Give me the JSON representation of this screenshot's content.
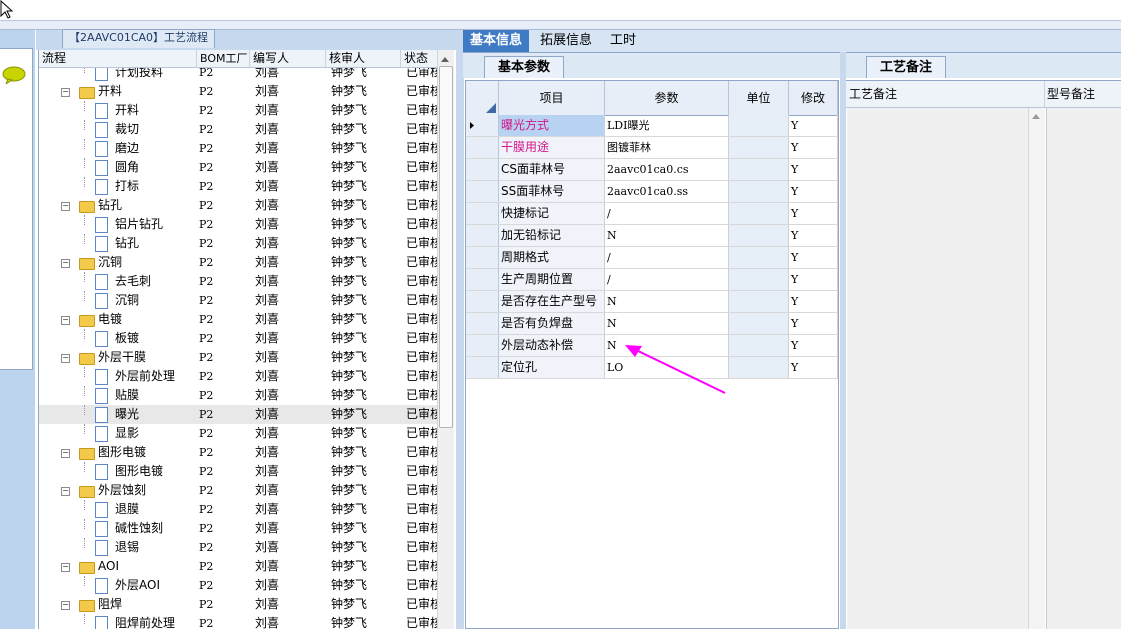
{
  "window": {
    "title": "【2AAVC01CA0】工艺流程"
  },
  "tree": {
    "columns": [
      "流程",
      "BOM工厂",
      "编写人",
      "核审人",
      "状态"
    ],
    "rows": [
      {
        "name": "计划投料",
        "type": "doc",
        "level": 1,
        "bom": "P2",
        "writer": "刘喜",
        "reviewer": "钟梦飞",
        "status": "已审核"
      },
      {
        "name": "开料",
        "type": "folder",
        "level": 0,
        "bom": "P2",
        "writer": "刘喜",
        "reviewer": "钟梦飞",
        "status": "已审核"
      },
      {
        "name": "开料",
        "type": "doc",
        "level": 1,
        "bom": "P2",
        "writer": "刘喜",
        "reviewer": "钟梦飞",
        "status": "已审核"
      },
      {
        "name": "裁切",
        "type": "doc",
        "level": 1,
        "bom": "P2",
        "writer": "刘喜",
        "reviewer": "钟梦飞",
        "status": "已审核"
      },
      {
        "name": "磨边",
        "type": "doc",
        "level": 1,
        "bom": "P2",
        "writer": "刘喜",
        "reviewer": "钟梦飞",
        "status": "已审核"
      },
      {
        "name": "圆角",
        "type": "doc",
        "level": 1,
        "bom": "P2",
        "writer": "刘喜",
        "reviewer": "钟梦飞",
        "status": "已审核"
      },
      {
        "name": "打标",
        "type": "doc",
        "level": 1,
        "bom": "P2",
        "writer": "刘喜",
        "reviewer": "钟梦飞",
        "status": "已审核"
      },
      {
        "name": "钻孔",
        "type": "folder",
        "level": 0,
        "bom": "P2",
        "writer": "刘喜",
        "reviewer": "钟梦飞",
        "status": "已审核"
      },
      {
        "name": "铝片钻孔",
        "type": "doc",
        "level": 1,
        "bom": "P2",
        "writer": "刘喜",
        "reviewer": "钟梦飞",
        "status": "已审核"
      },
      {
        "name": "钻孔",
        "type": "doc",
        "level": 1,
        "bom": "P2",
        "writer": "刘喜",
        "reviewer": "钟梦飞",
        "status": "已审核"
      },
      {
        "name": "沉铜",
        "type": "folder",
        "level": 0,
        "bom": "P2",
        "writer": "刘喜",
        "reviewer": "钟梦飞",
        "status": "已审核"
      },
      {
        "name": "去毛刺",
        "type": "doc",
        "level": 1,
        "bom": "P2",
        "writer": "刘喜",
        "reviewer": "钟梦飞",
        "status": "已审核"
      },
      {
        "name": "沉铜",
        "type": "doc",
        "level": 1,
        "bom": "P2",
        "writer": "刘喜",
        "reviewer": "钟梦飞",
        "status": "已审核"
      },
      {
        "name": "电镀",
        "type": "folder",
        "level": 0,
        "bom": "P2",
        "writer": "刘喜",
        "reviewer": "钟梦飞",
        "status": "已审核"
      },
      {
        "name": "板镀",
        "type": "doc",
        "level": 1,
        "bom": "P2",
        "writer": "刘喜",
        "reviewer": "钟梦飞",
        "status": "已审核"
      },
      {
        "name": "外层干膜",
        "type": "folder",
        "level": 0,
        "bom": "P2",
        "writer": "刘喜",
        "reviewer": "钟梦飞",
        "status": "已审核"
      },
      {
        "name": "外层前处理",
        "type": "doc",
        "level": 1,
        "bom": "P2",
        "writer": "刘喜",
        "reviewer": "钟梦飞",
        "status": "已审核"
      },
      {
        "name": "贴膜",
        "type": "doc",
        "level": 1,
        "bom": "P2",
        "writer": "刘喜",
        "reviewer": "钟梦飞",
        "status": "已审核"
      },
      {
        "name": "曝光",
        "type": "doc",
        "level": 1,
        "bom": "P2",
        "writer": "刘喜",
        "reviewer": "钟梦飞",
        "status": "已审核",
        "selected": true
      },
      {
        "name": "显影",
        "type": "doc",
        "level": 1,
        "bom": "P2",
        "writer": "刘喜",
        "reviewer": "钟梦飞",
        "status": "已审核"
      },
      {
        "name": "图形电镀",
        "type": "folder",
        "level": 0,
        "bom": "P2",
        "writer": "刘喜",
        "reviewer": "钟梦飞",
        "status": "已审核"
      },
      {
        "name": "图形电镀",
        "type": "doc",
        "level": 1,
        "bom": "P2",
        "writer": "刘喜",
        "reviewer": "钟梦飞",
        "status": "已审核"
      },
      {
        "name": "外层蚀刻",
        "type": "folder",
        "level": 0,
        "bom": "P2",
        "writer": "刘喜",
        "reviewer": "钟梦飞",
        "status": "已审核"
      },
      {
        "name": "退膜",
        "type": "doc",
        "level": 1,
        "bom": "P2",
        "writer": "刘喜",
        "reviewer": "钟梦飞",
        "status": "已审核"
      },
      {
        "name": "碱性蚀刻",
        "type": "doc",
        "level": 1,
        "bom": "P2",
        "writer": "刘喜",
        "reviewer": "钟梦飞",
        "status": "已审核"
      },
      {
        "name": "退锡",
        "type": "doc",
        "level": 1,
        "bom": "P2",
        "writer": "刘喜",
        "reviewer": "钟梦飞",
        "status": "已审核"
      },
      {
        "name": "AOI",
        "type": "folder",
        "level": 0,
        "bom": "P2",
        "writer": "刘喜",
        "reviewer": "钟梦飞",
        "status": "已审核"
      },
      {
        "name": "外层AOI",
        "type": "doc",
        "level": 1,
        "bom": "P2",
        "writer": "刘喜",
        "reviewer": "钟梦飞",
        "status": "已审核"
      },
      {
        "name": "阻焊",
        "type": "folder",
        "level": 0,
        "bom": "P2",
        "writer": "刘喜",
        "reviewer": "钟梦飞",
        "status": "已审核"
      },
      {
        "name": "阻焊前处理",
        "type": "doc",
        "level": 1,
        "bom": "P2",
        "writer": "刘喜",
        "reviewer": "钟梦飞",
        "status": "已审核"
      }
    ]
  },
  "tabs": [
    {
      "label": "基本信息",
      "active": true
    },
    {
      "label": "拓展信息",
      "active": false
    },
    {
      "label": "工时",
      "active": false
    }
  ],
  "params_panel": {
    "subtab": "基本参数",
    "columns": [
      "项目",
      "参数",
      "单位",
      "修改"
    ],
    "rows": [
      {
        "item": "曝光方式",
        "value": "LDI曝光",
        "unit": "",
        "mod": "Y",
        "highlight": "pink",
        "current": true
      },
      {
        "item": "干膜用途",
        "value": "图镀菲林",
        "unit": "",
        "mod": "Y",
        "highlight": "pink"
      },
      {
        "item": "CS面菲林号",
        "value": "2aavc01ca0.cs",
        "unit": "",
        "mod": "Y"
      },
      {
        "item": "SS面菲林号",
        "value": "2aavc01ca0.ss",
        "unit": "",
        "mod": "Y"
      },
      {
        "item": "快捷标记",
        "value": "/",
        "unit": "",
        "mod": "Y"
      },
      {
        "item": "加无铅标记",
        "value": "N",
        "unit": "",
        "mod": "Y"
      },
      {
        "item": "周期格式",
        "value": "/",
        "unit": "",
        "mod": "Y"
      },
      {
        "item": "生产周期位置",
        "value": "/",
        "unit": "",
        "mod": "Y"
      },
      {
        "item": "是否存在生产型号",
        "value": "N",
        "unit": "",
        "mod": "Y"
      },
      {
        "item": "是否有负焊盘",
        "value": "N",
        "unit": "",
        "mod": "Y"
      },
      {
        "item": "外层动态补偿",
        "value": "N",
        "unit": "",
        "mod": "Y"
      },
      {
        "item": "定位孔",
        "value": "LO",
        "unit": "",
        "mod": "Y"
      }
    ]
  },
  "remark_panel": {
    "subtab": "工艺备注",
    "columns": [
      "工艺备注",
      "型号备注"
    ]
  },
  "colors": {
    "pink_text": "#d4148a",
    "arrow": "#ff00ff",
    "tab_active": "#3f7ac4"
  }
}
